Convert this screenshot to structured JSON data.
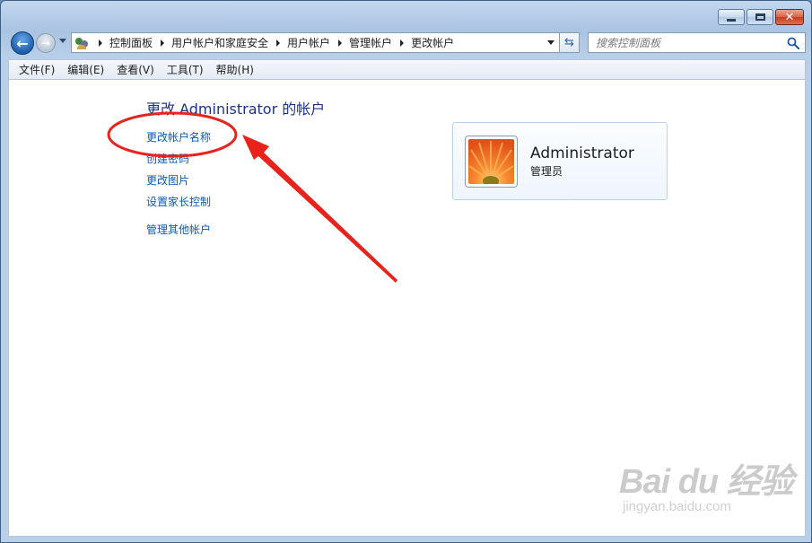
{
  "window": {
    "buttons": {
      "minimize": "minimize",
      "maximize": "maximize",
      "close": "close"
    }
  },
  "address_bar": {
    "breadcrumbs": [
      "控制面板",
      "用户帐户和家庭安全",
      "用户帐户",
      "管理帐户",
      "更改帐户"
    ]
  },
  "search": {
    "placeholder": "搜索控制面板"
  },
  "menu": [
    "文件(F)",
    "编辑(E)",
    "查看(V)",
    "工具(T)",
    "帮助(H)"
  ],
  "main": {
    "title": "更改 Administrator 的帐户",
    "tasks": [
      "更改帐户名称",
      "创建密码",
      "更改图片",
      "设置家长控制"
    ],
    "other_task": "管理其他帐户"
  },
  "account": {
    "name": "Administrator",
    "role": "管理员"
  },
  "watermark": {
    "logo": "Bai du 经验",
    "url": "jingyan.baidu.com"
  },
  "colors": {
    "link": "#0b5ab4",
    "title": "#1e3287",
    "annotation": "#e8231c"
  }
}
